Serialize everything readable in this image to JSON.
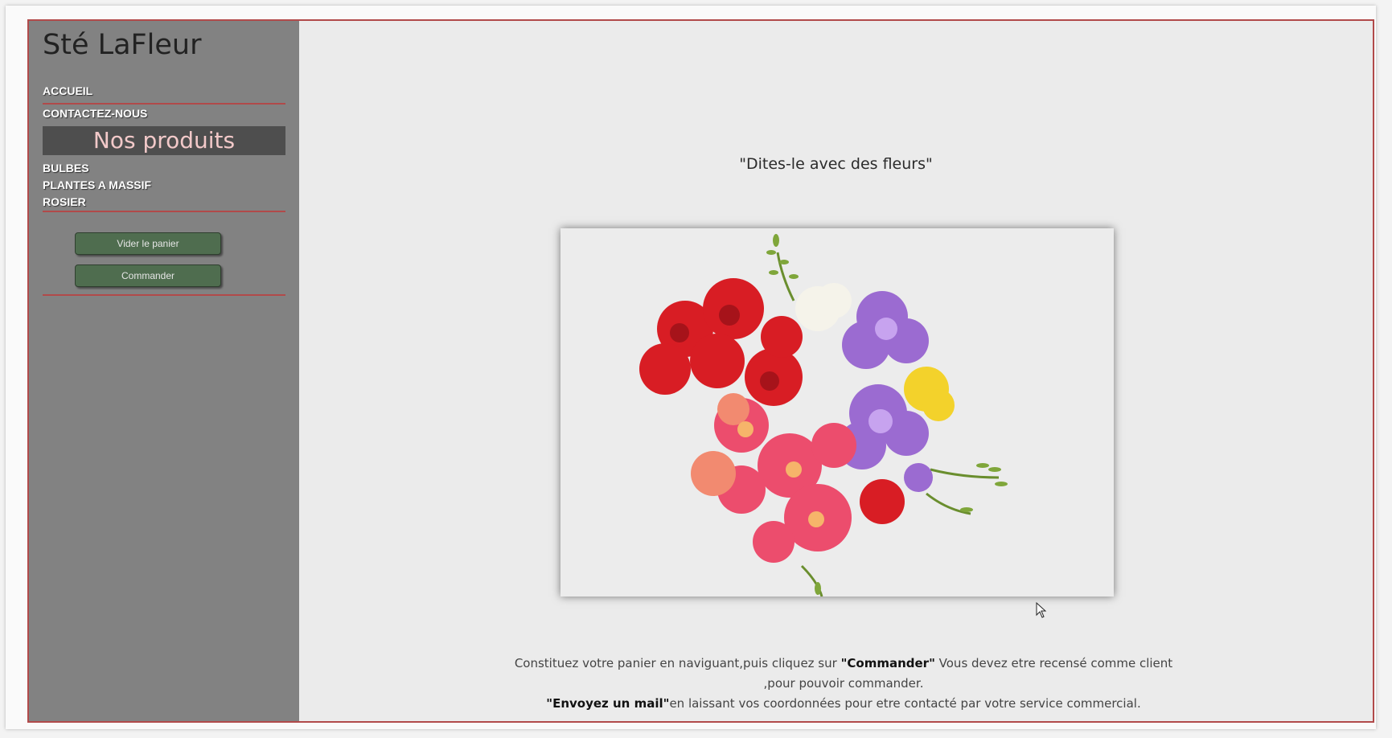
{
  "site": {
    "title": "Sté LaFleur"
  },
  "nav": {
    "home": "ACCUEIL",
    "contact": "CONTACTEZ-NOUS",
    "products_header": "Nos produits",
    "categories": [
      "BULBES",
      "PLANTES A MASSIF",
      "ROSIER"
    ]
  },
  "cart": {
    "empty_label": "Vider le panier",
    "order_label": "Commander"
  },
  "main": {
    "tagline": "\"Dites-le avec des fleurs\"",
    "image": {
      "subject": "flower-bouquet"
    },
    "intro": {
      "p1_before": "Constituez votre panier en naviguant,puis cliquez sur ",
      "p1_bold": "\"Commander\"",
      "p1_after": " Vous devez etre recensé comme client ,pour pouvoir commander.",
      "p2_bold": "\"Envoyez un mail\"",
      "p2_after": "en laissant vos coordonnées pour etre contacté par votre service commercial."
    }
  },
  "colors": {
    "sidebar_bg": "#828282",
    "accent_red": "#b14a4a",
    "button_green": "#4f6d4f",
    "header_text": "#f2c9c9"
  }
}
